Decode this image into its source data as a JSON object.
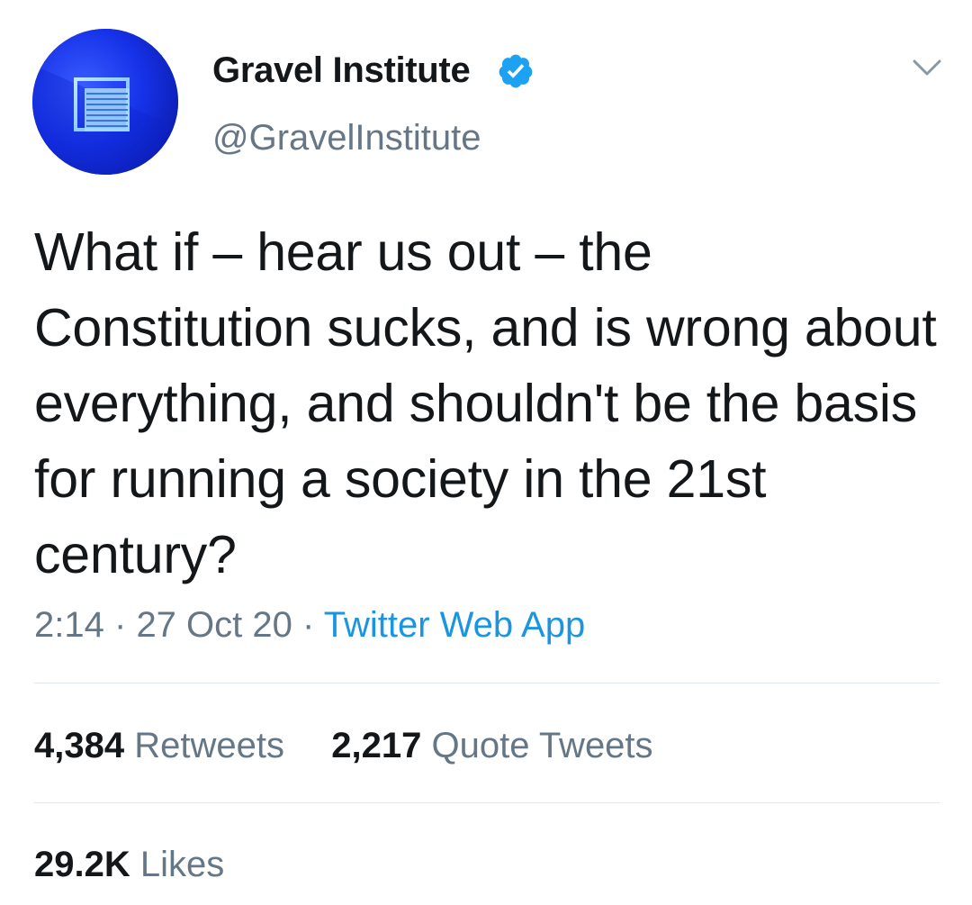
{
  "author": {
    "display_name": "Gravel Institute",
    "handle": "@GravelInstitute",
    "verified": true,
    "avatar_icon": "gravel-institute-logo",
    "avatar_color": "#1630e6"
  },
  "tweet": {
    "text": "What if – hear us out – the Constitution sucks, and is wrong about everything, and shouldn't be the basis for running a society in the 21st century?"
  },
  "meta": {
    "time": "2:14",
    "separator": "·",
    "date": "27 Oct 20",
    "source": "Twitter Web App"
  },
  "stats": {
    "retweets": {
      "count": "4,384",
      "label": "Retweets"
    },
    "quote_tweets": {
      "count": "2,217",
      "label": "Quote Tweets"
    },
    "likes": {
      "count": "29.2K",
      "label": "Likes"
    }
  },
  "colors": {
    "text_primary": "#14171a",
    "text_secondary": "#657786",
    "link": "#1b95e0",
    "verified_badge": "#1da1f2",
    "divider": "#e1e8ed"
  },
  "icons": {
    "verified": "verified-badge-icon",
    "more": "chevron-down-icon"
  }
}
